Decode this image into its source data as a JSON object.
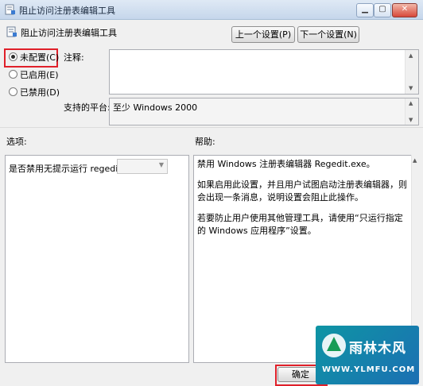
{
  "window": {
    "title": "阻止访问注册表编辑工具"
  },
  "header": {
    "policy_name": "阻止访问注册表编辑工具",
    "prev_button": "上一个设置(P)",
    "next_button": "下一个设置(N)"
  },
  "state": {
    "options": [
      {
        "label": "未配置(C)",
        "checked": true
      },
      {
        "label": "已启用(E)",
        "checked": false
      },
      {
        "label": "已禁用(D)",
        "checked": false
      }
    ]
  },
  "comment": {
    "label": "注释:",
    "value": ""
  },
  "platform": {
    "label": "支持的平台:",
    "value": "至少 Windows 2000"
  },
  "options_section": {
    "label": "选项:",
    "prompt": "是否禁用无提示运行 regedit？",
    "dropdown_value": ""
  },
  "help_section": {
    "label": "帮助:",
    "paragraphs": [
      "禁用 Windows 注册表编辑器 Regedit.exe。",
      "如果启用此设置，并且用户试图启动注册表编辑器，则会出现一条消息，说明设置会阻止此操作。",
      "若要防止用户使用其他管理工具，请使用“只运行指定的 Windows 应用程序”设置。"
    ]
  },
  "footer": {
    "ok_button": "确定"
  },
  "watermark": {
    "brand": "雨林木风",
    "url": "WWW.YLMFU.COM"
  },
  "colors": {
    "highlight": "#e0202a",
    "titlebar": "#c5d6eb",
    "watermark": "#0e95a4"
  }
}
